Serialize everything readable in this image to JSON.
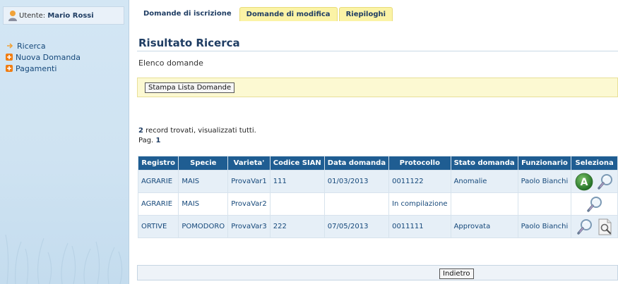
{
  "user": {
    "label": "Utente:",
    "name": "Mario Rossi"
  },
  "menu": [
    {
      "label": "Ricerca",
      "icon": "arrow-icon"
    },
    {
      "label": "Nuova Domanda",
      "icon": "plus-icon"
    },
    {
      "label": "Pagamenti",
      "icon": "plus-icon"
    }
  ],
  "tabs": [
    {
      "label": "Domande di iscrizione",
      "active": true
    },
    {
      "label": "Domande di modifica",
      "active": false
    },
    {
      "label": "Riepiloghi",
      "active": false
    }
  ],
  "title": "Risultato Ricerca",
  "subtitle": "Elenco domande",
  "print_button": "Stampa Lista Domande",
  "records": {
    "count": "2",
    "text": "record trovati, visualizzati tutti."
  },
  "pager": {
    "label": "Pag.",
    "page": "1"
  },
  "table": {
    "headers": [
      "Registro",
      "Specie",
      "Varieta'",
      "Codice SIAN",
      "Data domanda",
      "Protocollo",
      "Stato domanda",
      "Funzionario",
      "Seleziona"
    ],
    "rows": [
      [
        "AGRARIE",
        "MAIS",
        "ProvaVar1",
        "111",
        "01/03/2013",
        "0011122",
        "Anomalie",
        "Paolo Bianchi"
      ],
      [
        "AGRARIE",
        "MAIS",
        "ProvaVar2",
        "",
        "",
        "In compilazione",
        "",
        ""
      ],
      [
        "ORTIVE",
        "POMODORO",
        "ProvaVar3",
        "222",
        "07/05/2013",
        "0011111",
        "Approvata",
        "Paolo Bianchi"
      ]
    ],
    "row_actions": [
      [
        "anomaly-badge-icon",
        "magnifier-icon"
      ],
      [
        "magnifier-icon"
      ],
      [
        "magnifier-icon",
        "document-view-icon"
      ]
    ],
    "anomaly_letter": "A"
  },
  "back_button": "Indietro",
  "colors": {
    "header_bg": "#1f5d92",
    "title": "#1f3d63",
    "tab_inactive": "#fbf3a6",
    "action_bar": "#fcf9d2",
    "accent_orange": "#f07d12",
    "anomaly_green": "#2f8a2f"
  }
}
